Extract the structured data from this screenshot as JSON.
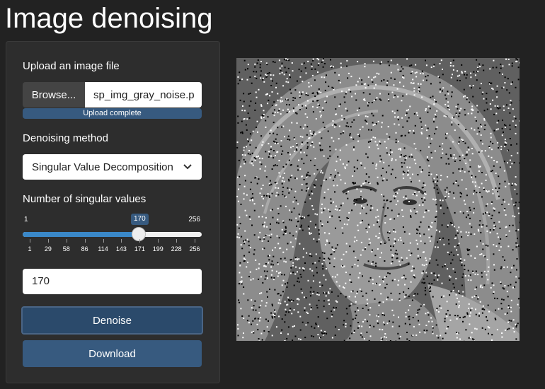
{
  "title": "Image denoising",
  "upload": {
    "label": "Upload an image file",
    "browse_label": "Browse...",
    "file_name": "sp_img_gray_noise.p",
    "progress_text": "Upload complete"
  },
  "method": {
    "label": "Denoising method",
    "selected": "Singular Value Decomposition"
  },
  "singular": {
    "label": "Number of singular values",
    "min": 1,
    "max": 256,
    "value": 170,
    "min_label": "1",
    "max_label": "256",
    "value_label": "170",
    "ticks": [
      "1",
      "29",
      "58",
      "86",
      "114",
      "143",
      "171",
      "199",
      "228",
      "256"
    ]
  },
  "numeric_input": {
    "value": "170"
  },
  "buttons": {
    "denoise": "Denoise",
    "download": "Download"
  },
  "colors": {
    "background": "#222222",
    "panel": "#2d2d2d",
    "accent": "#375a7f",
    "slider_fill": "#3a88c8"
  },
  "icons": {
    "select_chevron": "chevron-down-icon"
  }
}
